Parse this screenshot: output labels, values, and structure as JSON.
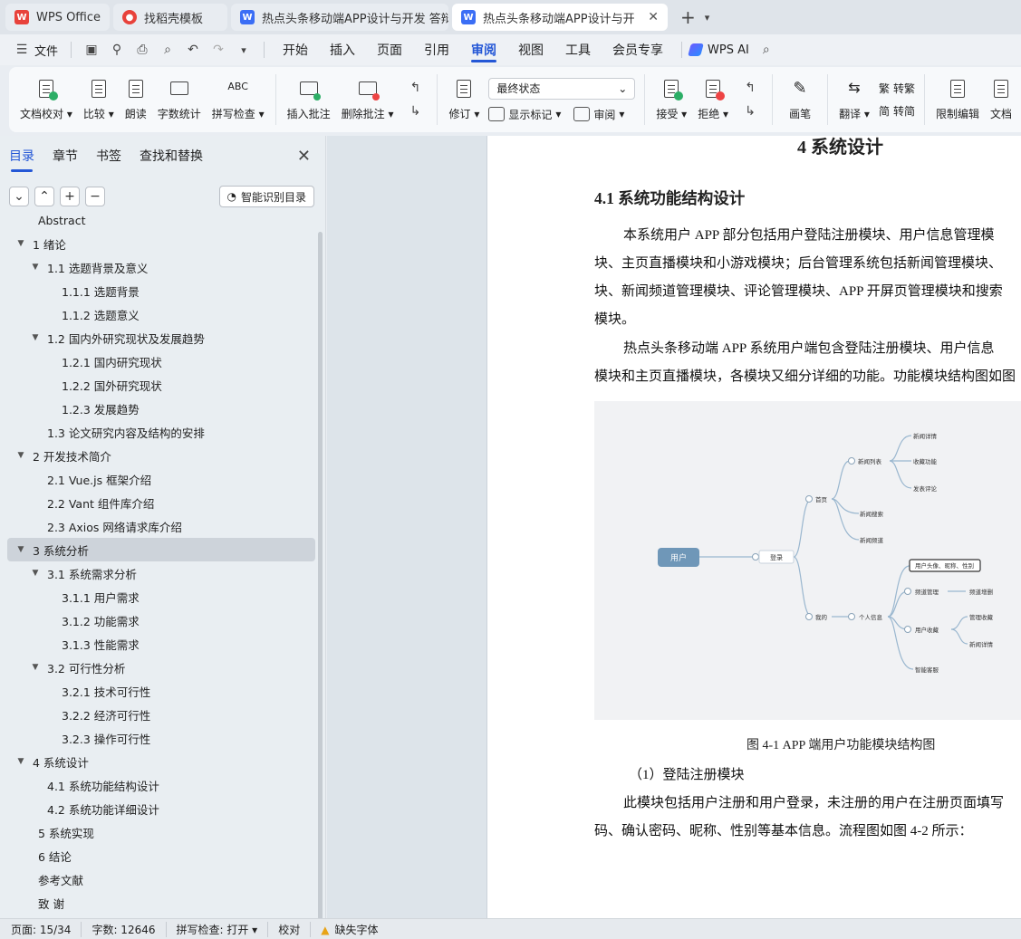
{
  "tabs": [
    {
      "label": "WPS Office",
      "logo": "wps-logo"
    },
    {
      "label": "找稻壳模板",
      "logo": "daoke-logo"
    },
    {
      "label": "热点头条移动端APP设计与开发 答辩",
      "logo": "word-logo"
    },
    {
      "label": "热点头条移动端APP设计与开发",
      "logo": "word-logo"
    }
  ],
  "menu": {
    "file": "文件",
    "items": [
      "开始",
      "插入",
      "页面",
      "引用",
      "审阅",
      "视图",
      "工具",
      "会员专享"
    ],
    "active": "审阅",
    "ai": "WPS AI"
  },
  "ribbon": {
    "doc_check": "文档校对",
    "compare": "比较",
    "read": "朗读",
    "word_count": "字数统计",
    "spell_check": "拼写检查",
    "insert_comment": "插入批注",
    "delete_comment": "删除批注",
    "revise": "修订",
    "status_select": "最终状态",
    "show_marks": "显示标记",
    "review": "审阅",
    "accept": "接受",
    "reject": "拒绝",
    "pen": "画笔",
    "translate": "翻译",
    "to_traditional": "转繁",
    "to_simplified": "转简",
    "restrict_edit": "限制编辑",
    "doc_more": "文档"
  },
  "sidebar": {
    "tabs": [
      "目录",
      "章节",
      "书签",
      "查找和替换"
    ],
    "smart_button": "智能识别目录",
    "toc": [
      {
        "label": "Abstract",
        "level": 0,
        "toggle": false
      },
      {
        "label": "1  绪论",
        "level": 0,
        "toggle": true
      },
      {
        "label": "1.1  选题背景及意义",
        "level": 1,
        "toggle": true
      },
      {
        "label": "1.1.1  选题背景",
        "level": 2,
        "toggle": false
      },
      {
        "label": "1.1.2  选题意义",
        "level": 2,
        "toggle": false
      },
      {
        "label": "1.2  国内外研究现状及发展趋势",
        "level": 1,
        "toggle": true
      },
      {
        "label": "1.2.1  国内研究现状",
        "level": 2,
        "toggle": false
      },
      {
        "label": "1.2.2  国外研究现状",
        "level": 2,
        "toggle": false
      },
      {
        "label": "1.2.3  发展趋势",
        "level": 2,
        "toggle": false
      },
      {
        "label": "1.3 论文研究内容及结构的安排",
        "level": 1,
        "toggle": false
      },
      {
        "label": "2  开发技术简介",
        "level": 0,
        "toggle": true
      },
      {
        "label": "2.1 Vue.js 框架介绍",
        "level": 1,
        "toggle": false
      },
      {
        "label": "2.2 Vant 组件库介绍",
        "level": 1,
        "toggle": false
      },
      {
        "label": "2.3 Axios 网络请求库介绍",
        "level": 1,
        "toggle": false
      },
      {
        "label": "3  系统分析",
        "level": 0,
        "toggle": true,
        "selected": true
      },
      {
        "label": "3.1  系统需求分析",
        "level": 1,
        "toggle": true
      },
      {
        "label": "3.1.1  用户需求",
        "level": 2,
        "toggle": false
      },
      {
        "label": "3.1.2  功能需求",
        "level": 2,
        "toggle": false
      },
      {
        "label": "3.1.3  性能需求",
        "level": 2,
        "toggle": false
      },
      {
        "label": "3.2  可行性分析",
        "level": 1,
        "toggle": true
      },
      {
        "label": "3.2.1  技术可行性",
        "level": 2,
        "toggle": false
      },
      {
        "label": "3.2.2  经济可行性",
        "level": 2,
        "toggle": false
      },
      {
        "label": "3.2.3  操作可行性",
        "level": 2,
        "toggle": false
      },
      {
        "label": "4  系统设计",
        "level": 0,
        "toggle": true
      },
      {
        "label": "4.1  系统功能结构设计",
        "level": 1,
        "toggle": false
      },
      {
        "label": "4.2  系统功能详细设计",
        "level": 1,
        "toggle": false
      },
      {
        "label": "5  系统实现",
        "level": 0,
        "toggle": false
      },
      {
        "label": "6  结论",
        "level": 0,
        "toggle": false
      },
      {
        "label": "参考文献",
        "level": 0,
        "toggle": false
      },
      {
        "label": "致     谢",
        "level": 0,
        "toggle": false
      }
    ]
  },
  "document": {
    "heading1": "4  系统设计",
    "heading2": "4.1  系统功能结构设计",
    "paragraphs": [
      "本系统用户 APP 部分包括用户登陆注册模块、用户信息管理模",
      "块、主页直播模块和小游戏模块；后台管理系统包括新闻管理模块、",
      "块、新闻频道管理模块、评论管理模块、APP 开屏页管理模块和搜索",
      "模块。",
      "热点头条移动端 APP 系统用户端包含登陆注册模块、用户信息",
      "模块和主页直播模块，各模块又细分详细的功能。功能模块结构图如图"
    ],
    "caption": "图 4-1   APP 端用户功能模块结构图",
    "after": [
      "（1）登陆注册模块",
      "此模块包括用户注册和用户登录，未注册的用户在注册页面填写",
      "码、确认密码、昵称、性别等基本信息。流程图如图 4-2 所示："
    ],
    "mindmap": {
      "root": "用户",
      "login": "登录",
      "home": "首页",
      "mine": "我的",
      "news_list": "新闻列表",
      "news_detail": "新闻详情",
      "favorite": "收藏功能",
      "comment": "发表评论",
      "news_search": "新闻搜索",
      "news_channel": "新闻频道",
      "profile": "个人信息",
      "profile_detail": "用户头像、昵称、性别",
      "channel_manage": "频道管理",
      "channel_delete": "频道增删",
      "user_fav": "用户收藏",
      "manage_fav": "管理收藏",
      "fav_detail": "新闻详情",
      "ai_service": "智能客服"
    }
  },
  "status": {
    "page": "页面: 15/34",
    "words": "字数: 12646",
    "spell": "拼写检查: 打开",
    "proof": "校对",
    "missing_font": "缺失字体"
  }
}
